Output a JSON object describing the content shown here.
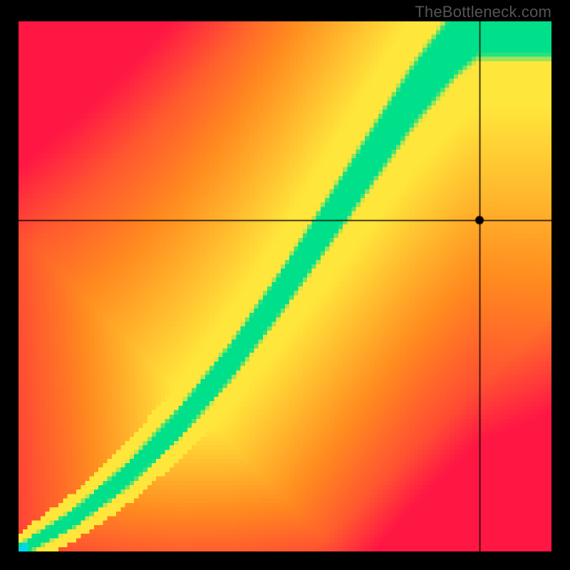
{
  "watermark": "TheBottleneck.com",
  "chart_data": {
    "type": "heatmap",
    "title": "",
    "xlabel": "",
    "ylabel": "",
    "xlim": [
      0,
      1
    ],
    "ylim": [
      0,
      1
    ],
    "grid": false,
    "colorbar": false,
    "resolution": 120,
    "marker": {
      "x": 0.865,
      "y": 0.625,
      "radius": 6
    },
    "crosshair": {
      "x": 0.865,
      "y": 0.625
    },
    "ridge": {
      "comment": "green optimal-balance ridge as (x, y) control points in normalized 0..1 space, y measured from bottom",
      "points": [
        [
          0.0,
          0.0
        ],
        [
          0.1,
          0.06
        ],
        [
          0.2,
          0.14
        ],
        [
          0.3,
          0.24
        ],
        [
          0.4,
          0.36
        ],
        [
          0.5,
          0.5
        ],
        [
          0.58,
          0.62
        ],
        [
          0.66,
          0.74
        ],
        [
          0.74,
          0.86
        ],
        [
          0.82,
          0.96
        ],
        [
          0.86,
          1.0
        ]
      ],
      "half_width_start": 0.01,
      "half_width_end": 0.06
    },
    "ridge_color": "#00e08a",
    "palette": {
      "red": "#ff1744",
      "orange": "#ff8a1f",
      "yellow": "#ffe63b",
      "green": "#00e08a"
    }
  }
}
